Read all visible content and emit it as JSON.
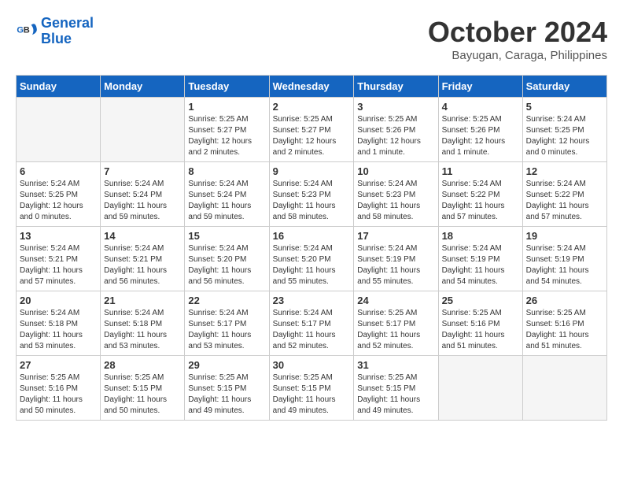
{
  "logo": {
    "line1": "General",
    "line2": "Blue"
  },
  "title": "October 2024",
  "subtitle": "Bayugan, Caraga, Philippines",
  "weekdays": [
    "Sunday",
    "Monday",
    "Tuesday",
    "Wednesday",
    "Thursday",
    "Friday",
    "Saturday"
  ],
  "weeks": [
    [
      {
        "day": "",
        "info": ""
      },
      {
        "day": "",
        "info": ""
      },
      {
        "day": "1",
        "info": "Sunrise: 5:25 AM\nSunset: 5:27 PM\nDaylight: 12 hours\nand 2 minutes."
      },
      {
        "day": "2",
        "info": "Sunrise: 5:25 AM\nSunset: 5:27 PM\nDaylight: 12 hours\nand 2 minutes."
      },
      {
        "day": "3",
        "info": "Sunrise: 5:25 AM\nSunset: 5:26 PM\nDaylight: 12 hours\nand 1 minute."
      },
      {
        "day": "4",
        "info": "Sunrise: 5:25 AM\nSunset: 5:26 PM\nDaylight: 12 hours\nand 1 minute."
      },
      {
        "day": "5",
        "info": "Sunrise: 5:24 AM\nSunset: 5:25 PM\nDaylight: 12 hours\nand 0 minutes."
      }
    ],
    [
      {
        "day": "6",
        "info": "Sunrise: 5:24 AM\nSunset: 5:25 PM\nDaylight: 12 hours\nand 0 minutes."
      },
      {
        "day": "7",
        "info": "Sunrise: 5:24 AM\nSunset: 5:24 PM\nDaylight: 11 hours\nand 59 minutes."
      },
      {
        "day": "8",
        "info": "Sunrise: 5:24 AM\nSunset: 5:24 PM\nDaylight: 11 hours\nand 59 minutes."
      },
      {
        "day": "9",
        "info": "Sunrise: 5:24 AM\nSunset: 5:23 PM\nDaylight: 11 hours\nand 58 minutes."
      },
      {
        "day": "10",
        "info": "Sunrise: 5:24 AM\nSunset: 5:23 PM\nDaylight: 11 hours\nand 58 minutes."
      },
      {
        "day": "11",
        "info": "Sunrise: 5:24 AM\nSunset: 5:22 PM\nDaylight: 11 hours\nand 57 minutes."
      },
      {
        "day": "12",
        "info": "Sunrise: 5:24 AM\nSunset: 5:22 PM\nDaylight: 11 hours\nand 57 minutes."
      }
    ],
    [
      {
        "day": "13",
        "info": "Sunrise: 5:24 AM\nSunset: 5:21 PM\nDaylight: 11 hours\nand 57 minutes."
      },
      {
        "day": "14",
        "info": "Sunrise: 5:24 AM\nSunset: 5:21 PM\nDaylight: 11 hours\nand 56 minutes."
      },
      {
        "day": "15",
        "info": "Sunrise: 5:24 AM\nSunset: 5:20 PM\nDaylight: 11 hours\nand 56 minutes."
      },
      {
        "day": "16",
        "info": "Sunrise: 5:24 AM\nSunset: 5:20 PM\nDaylight: 11 hours\nand 55 minutes."
      },
      {
        "day": "17",
        "info": "Sunrise: 5:24 AM\nSunset: 5:19 PM\nDaylight: 11 hours\nand 55 minutes."
      },
      {
        "day": "18",
        "info": "Sunrise: 5:24 AM\nSunset: 5:19 PM\nDaylight: 11 hours\nand 54 minutes."
      },
      {
        "day": "19",
        "info": "Sunrise: 5:24 AM\nSunset: 5:19 PM\nDaylight: 11 hours\nand 54 minutes."
      }
    ],
    [
      {
        "day": "20",
        "info": "Sunrise: 5:24 AM\nSunset: 5:18 PM\nDaylight: 11 hours\nand 53 minutes."
      },
      {
        "day": "21",
        "info": "Sunrise: 5:24 AM\nSunset: 5:18 PM\nDaylight: 11 hours\nand 53 minutes."
      },
      {
        "day": "22",
        "info": "Sunrise: 5:24 AM\nSunset: 5:17 PM\nDaylight: 11 hours\nand 53 minutes."
      },
      {
        "day": "23",
        "info": "Sunrise: 5:24 AM\nSunset: 5:17 PM\nDaylight: 11 hours\nand 52 minutes."
      },
      {
        "day": "24",
        "info": "Sunrise: 5:25 AM\nSunset: 5:17 PM\nDaylight: 11 hours\nand 52 minutes."
      },
      {
        "day": "25",
        "info": "Sunrise: 5:25 AM\nSunset: 5:16 PM\nDaylight: 11 hours\nand 51 minutes."
      },
      {
        "day": "26",
        "info": "Sunrise: 5:25 AM\nSunset: 5:16 PM\nDaylight: 11 hours\nand 51 minutes."
      }
    ],
    [
      {
        "day": "27",
        "info": "Sunrise: 5:25 AM\nSunset: 5:16 PM\nDaylight: 11 hours\nand 50 minutes."
      },
      {
        "day": "28",
        "info": "Sunrise: 5:25 AM\nSunset: 5:15 PM\nDaylight: 11 hours\nand 50 minutes."
      },
      {
        "day": "29",
        "info": "Sunrise: 5:25 AM\nSunset: 5:15 PM\nDaylight: 11 hours\nand 49 minutes."
      },
      {
        "day": "30",
        "info": "Sunrise: 5:25 AM\nSunset: 5:15 PM\nDaylight: 11 hours\nand 49 minutes."
      },
      {
        "day": "31",
        "info": "Sunrise: 5:25 AM\nSunset: 5:15 PM\nDaylight: 11 hours\nand 49 minutes."
      },
      {
        "day": "",
        "info": ""
      },
      {
        "day": "",
        "info": ""
      }
    ]
  ]
}
